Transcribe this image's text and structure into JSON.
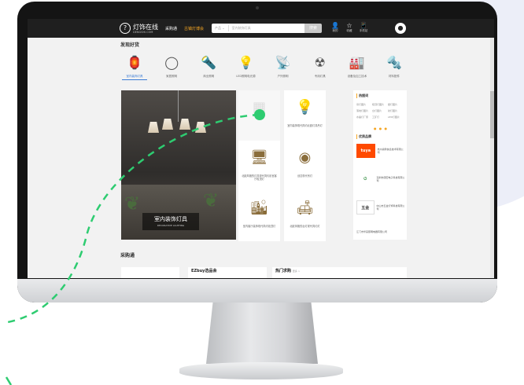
{
  "nav": {
    "logo_text": "灯饰在线",
    "logo_sub": "DENGSHI.COM",
    "link_procurement": "采购通",
    "link_ad": "古镇灯博会",
    "search_category": "产品 ⌄",
    "search_placeholder": "室内装饰灯具",
    "search_button": "搜索",
    "icons": [
      {
        "name": "user-icon",
        "glyph": "👤",
        "label": "我的"
      },
      {
        "name": "star-icon",
        "glyph": "☆",
        "label": "收藏"
      },
      {
        "name": "phone-icon",
        "glyph": "📱",
        "label": "手机站"
      }
    ],
    "avatar_glyph": "●"
  },
  "sections": {
    "discover": "发现好货",
    "procurement": "采购通"
  },
  "categories": [
    {
      "label": "室内装饰灯具",
      "glyph": "🏮",
      "active": true
    },
    {
      "label": "家居照明",
      "glyph": "◯",
      "active": false
    },
    {
      "label": "商业照明",
      "glyph": "🔦",
      "active": false
    },
    {
      "label": "LED照明电光源",
      "glyph": "💡",
      "active": false
    },
    {
      "label": "户外照明",
      "glyph": "📡",
      "active": false
    },
    {
      "label": "专用灯具",
      "glyph": "☢",
      "active": false
    },
    {
      "label": "设备及加工技术",
      "glyph": "🏭",
      "active": false
    },
    {
      "label": "材料配件",
      "glyph": "🔩",
      "active": false
    }
  ],
  "hero": {
    "caption_title": "室内装饰灯具",
    "caption_sub": "DECORATIVE LIGHTING"
  },
  "products": [
    {
      "text": "",
      "glyph": "▦"
    },
    {
      "text": "室内装饰现代简约北欧灯具吊灯",
      "glyph": "💡"
    },
    {
      "text": "北欧风格的灯具现代简约卧室客厅吸顶灯",
      "glyph": "🖥"
    },
    {
      "text": "创意现代吊灯",
      "glyph": "◉"
    },
    {
      "text": "室内客厅装饰现代简约吸顶灯",
      "glyph": "🏙"
    },
    {
      "text": "北欧风格的台灯现代简约灯",
      "glyph": "🛋"
    }
  ],
  "panel": {
    "hot_title": "热搜词",
    "hot_tags": [
      "吊灯图片",
      "吸顶灯图片",
      "壁灯图片",
      "落地灯图片",
      "台灯图片",
      "射灯图片",
      "水晶灯厂家",
      "工矿灯",
      "LED灯图片"
    ],
    "dots": "● ● ●",
    "brand_title": "优质品牌",
    "brands": [
      {
        "logo": "tuya",
        "name": "杭州涂鸦信息技术有限公司",
        "color": "#ff4a00"
      },
      {
        "logo": "⏻",
        "name": "深圳市康宏电子科技有限公司",
        "color": "#2e8b3d"
      },
      {
        "logo": "五金",
        "name": "中山市五金灯饰科技有限公司",
        "color": "#444444"
      }
    ],
    "brand_last": "江门市华亮照明电器有限公司"
  },
  "bottom": {
    "ezbuy_title": "EZbuy选品会",
    "hot_title": "热门求购",
    "hot_more": "更多 >"
  },
  "colors": {
    "accent": "#3a7bd5",
    "highlight": "#f5a623",
    "dashed_path": "#2ecc71"
  }
}
